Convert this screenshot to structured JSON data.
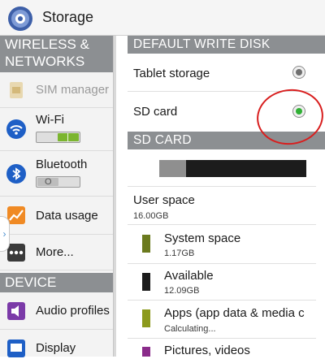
{
  "app": {
    "title": "Storage"
  },
  "sidebar": {
    "sections": [
      {
        "header": "WIRELESS & NETWORKS"
      },
      {
        "header": "DEVICE"
      }
    ],
    "items": [
      {
        "label": "SIM manager",
        "icon": "sim-card-icon",
        "enabled": false
      },
      {
        "label": "Wi-Fi",
        "icon": "wifi-icon",
        "toggle_state": "on"
      },
      {
        "label": "Bluetooth",
        "icon": "bluetooth-icon",
        "toggle_state": "off"
      },
      {
        "label": "Data usage",
        "icon": "data-usage-icon"
      },
      {
        "label": "More...",
        "icon": "more-icon"
      },
      {
        "label": "Audio profiles",
        "icon": "audio-profiles-icon"
      },
      {
        "label": "Display",
        "icon": "display-icon"
      }
    ]
  },
  "main": {
    "default_write_disk": {
      "header": "DEFAULT WRITE DISK",
      "options": [
        {
          "label": "Tablet storage",
          "selected": false
        },
        {
          "label": "SD card",
          "selected": true
        }
      ]
    },
    "sd_card": {
      "header": "SD CARD",
      "usage_fraction": 0.18,
      "entries": [
        {
          "title": "User space",
          "value": "16.00GB"
        },
        {
          "title": "System space",
          "value": "1.17GB",
          "color": "#6b7a1e"
        },
        {
          "title": "Available",
          "value": "12.09GB",
          "color": "#1c1c1c"
        },
        {
          "title": "Apps (app data & media c",
          "value": "Calculating...",
          "color": "#8c9a1c"
        },
        {
          "title": "Pictures, videos",
          "value": "",
          "color": "#8a2b8a"
        }
      ]
    }
  },
  "colors": {
    "section_header": "#8c8f92",
    "selected_radio": "#30b035",
    "annotation": "#d81e1e",
    "wifi_toggle_on": "#7bb52f"
  }
}
